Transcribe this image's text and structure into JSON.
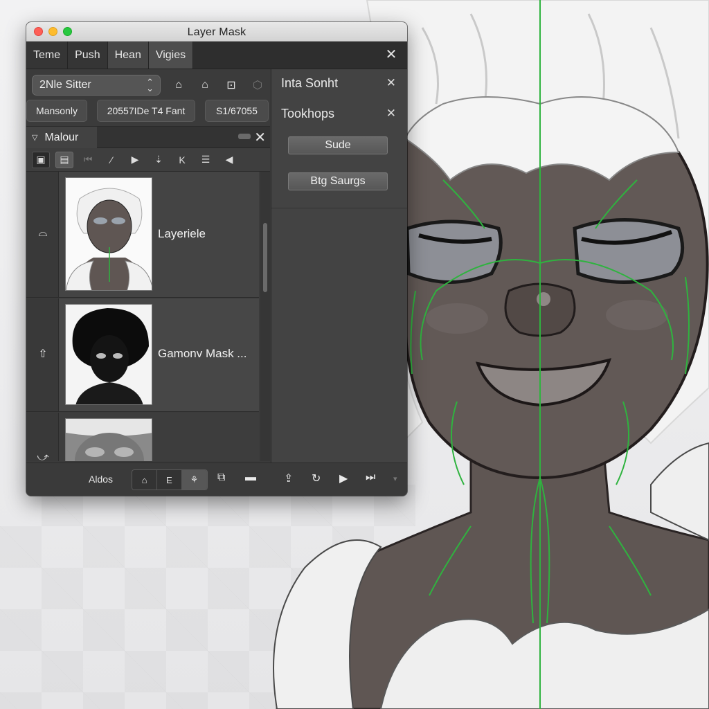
{
  "window": {
    "title": "Layer Mask",
    "tabs": [
      {
        "label": "Teme"
      },
      {
        "label": "Push"
      },
      {
        "label": "Hean"
      },
      {
        "label": "Vigies"
      }
    ]
  },
  "toolbar": {
    "select_value": "2Nle Sitter",
    "pills": [
      "Mansonly",
      "20557IDe T4 Fant",
      "S1/67055"
    ]
  },
  "layers_panel": {
    "title": "Malour",
    "layers": [
      {
        "name": "Layeriele"
      },
      {
        "name": "Gamonv Mask ..."
      },
      {
        "name": ""
      }
    ]
  },
  "bottom_bar": {
    "label": "Aldos",
    "group": [
      "⌂",
      "E",
      "⚘"
    ]
  },
  "right_panel": {
    "rows": [
      {
        "label": "Inta Sonht"
      },
      {
        "label": "Tookhops"
      }
    ],
    "buttons": [
      {
        "label": "Sude"
      },
      {
        "label": "Btg Saurgs"
      }
    ]
  },
  "colors": {
    "panel_bg": "#3a3a3a",
    "mask_line": "#2fb33f",
    "skin": "#5e5552",
    "hair": "#f2f2f2"
  }
}
